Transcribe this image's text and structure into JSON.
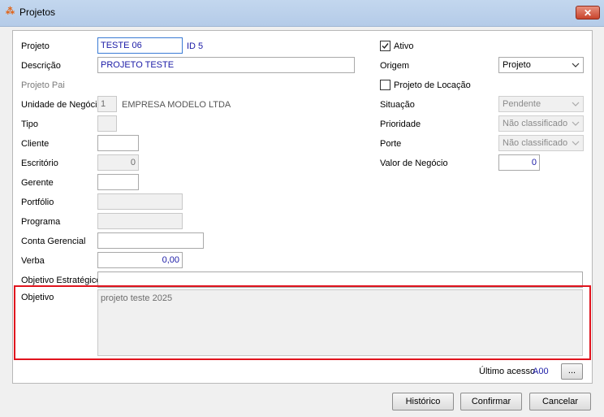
{
  "window": {
    "title": "Projetos",
    "close_symbol": "✕"
  },
  "form": {
    "projeto": {
      "label": "Projeto",
      "value": "TESTE 06"
    },
    "id": {
      "label": "ID",
      "value": "5"
    },
    "descricao": {
      "label": "Descrição",
      "value": "PROJETO TESTE"
    },
    "projeto_pai": {
      "label": "Projeto Pai"
    },
    "unidade_negocio": {
      "label": "Unidade de Negócio",
      "code": "1",
      "name": "EMPRESA MODELO LTDA"
    },
    "tipo": {
      "label": "Tipo",
      "value": ""
    },
    "cliente": {
      "label": "Cliente",
      "value": ""
    },
    "escritorio": {
      "label": "Escritório",
      "value": "0"
    },
    "gerente": {
      "label": "Gerente",
      "value": ""
    },
    "portfolio": {
      "label": "Portfólio",
      "value": ""
    },
    "programa": {
      "label": "Programa",
      "value": ""
    },
    "conta_gerencial": {
      "label": "Conta Gerencial",
      "value": ""
    },
    "verba": {
      "label": "Verba",
      "value": "0,00"
    },
    "objetivo_estrategico": {
      "label": "Objetivo Estratégico",
      "value": ""
    },
    "objetivo": {
      "label": "Objetivo",
      "value": "projeto teste 2025"
    },
    "ativo": {
      "label": "Ativo",
      "checked": true
    },
    "origem": {
      "label": "Origem",
      "value": "Projeto"
    },
    "projeto_locacao": {
      "label": "Projeto de Locação",
      "checked": false
    },
    "situacao": {
      "label": "Situação",
      "value": "Pendente"
    },
    "prioridade": {
      "label": "Prioridade",
      "value": "Não classificado"
    },
    "porte": {
      "label": "Porte",
      "value": "Não classificado"
    },
    "valor_negocio": {
      "label": "Valor de Negócio",
      "value": "0"
    },
    "ultimo_acesso": {
      "label": "Último acesso",
      "value": "A00",
      "button": "..."
    }
  },
  "buttons": {
    "historico": "Histórico",
    "confirmar": "Confirmar",
    "cancelar": "Cancelar"
  }
}
